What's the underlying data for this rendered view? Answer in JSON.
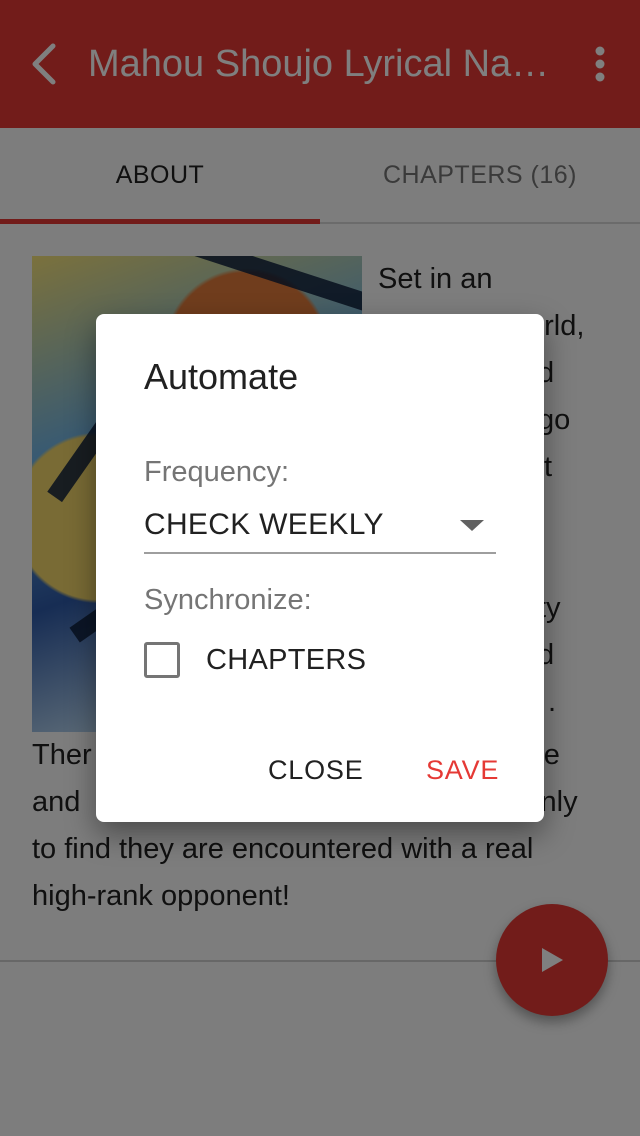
{
  "appbar": {
    "title": "Mahou Shoujo Lyrical Nanoha Vivid",
    "back_icon": "arrow-back-icon",
    "menu_icon": "more-vert-icon",
    "color": "#e53935"
  },
  "tabs": [
    {
      "label": "ABOUT",
      "active": true
    },
    {
      "label": "CHAPTERS (16)",
      "active": false
    }
  ],
  "synopsis": "Set in an alternate world, Takamachi Vivio, ... There ... and ... only to find they are encountered with a real high-rank opponent!",
  "synopsis_visible": {
    "line1": "Set in an",
    "fragment_orld": "orld,",
    "fragment_d1": "d",
    "fragment_go": "go",
    "fragment_t": "t",
    "fragment_ty": "ty",
    "fragment_d2": "d",
    "fragment_dot": ".",
    "line_ther": "Ther",
    "fragment_te": "te",
    "line_and": "and",
    "fragment_only": "only",
    "line_find": "to find they are encountered with a real",
    "line_last": "high-rank opponent!"
  },
  "fab": {
    "icon": "play-icon"
  },
  "dialog": {
    "title": "Automate",
    "frequency_label": "Frequency:",
    "frequency_value": "CHECK WEEKLY",
    "synchronize_label": "Synchronize:",
    "chapters_checkbox_label": "CHAPTERS",
    "chapters_checked": false,
    "close_label": "CLOSE",
    "save_label": "SAVE",
    "accent": "#e53935"
  }
}
